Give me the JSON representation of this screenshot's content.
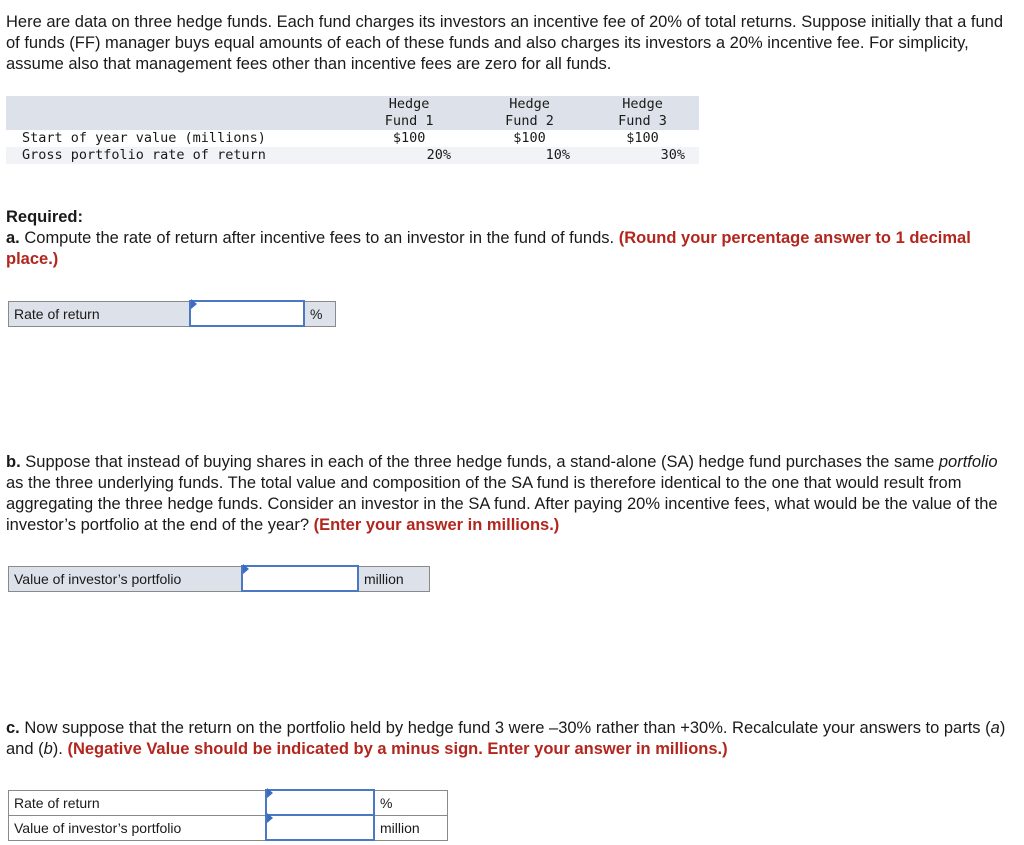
{
  "intro": "Here are data on three hedge funds. Each fund charges its investors an incentive fee of 20% of total returns. Suppose initially that a fund of funds (FF) manager buys equal amounts of each of these funds and also charges its investors a 20% incentive fee. For simplicity, assume also that management fees other than incentive fees are zero for all funds.",
  "table": {
    "headers": [
      {
        "line1": "Hedge",
        "line2": "Fund 1"
      },
      {
        "line1": "Hedge",
        "line2": "Fund 2"
      },
      {
        "line1": "Hedge",
        "line2": "Fund 3"
      }
    ],
    "rows": [
      {
        "label": "Start of year value (millions)",
        "values": [
          "$100",
          "$100",
          "$100"
        ]
      },
      {
        "label": "Gross portfolio rate of return",
        "values": [
          "20%",
          "10%",
          "30%"
        ]
      }
    ]
  },
  "required_label": "Required:",
  "part_a": {
    "letter": "a.",
    "text": " Compute the rate of return after incentive fees to an investor in the fund of funds. ",
    "instruction": "(Round your percentage answer to 1 decimal place.)",
    "answers": [
      {
        "label": "Rate of return",
        "value": "",
        "unit": "%"
      }
    ]
  },
  "part_b": {
    "letter": "b.",
    "text_1": " Suppose that instead of buying shares in each of the three hedge funds, a stand-alone (SA) hedge fund purchases the same ",
    "text_italic": "portfolio",
    "text_2": " as the three underlying funds. The total value and composition of the SA fund is therefore identical to the one that would result from aggregating the three hedge funds. Consider an investor in the SA fund. After paying 20% incentive fees, what would be the value of the investor’s portfolio at the end of the year? ",
    "instruction": "(Enter your answer in millions.)",
    "answers": [
      {
        "label": "Value of investor’s portfolio",
        "value": "",
        "unit": "million"
      }
    ]
  },
  "part_c": {
    "letter": "c.",
    "text_1": " Now suppose that the return on the portfolio held by hedge fund 3 were –30% rather than +30%. Recalculate your answers to parts (",
    "ref_a": "a",
    "text_2": ") and (",
    "ref_b": "b",
    "text_3": "). ",
    "instruction": "(Negative Value should be indicated by a minus sign. Enter your answer in millions.)",
    "answers": [
      {
        "label": "Rate of return",
        "value": "",
        "unit": "%"
      },
      {
        "label": "Value of investor’s portfolio",
        "value": "",
        "unit": "million"
      }
    ]
  }
}
